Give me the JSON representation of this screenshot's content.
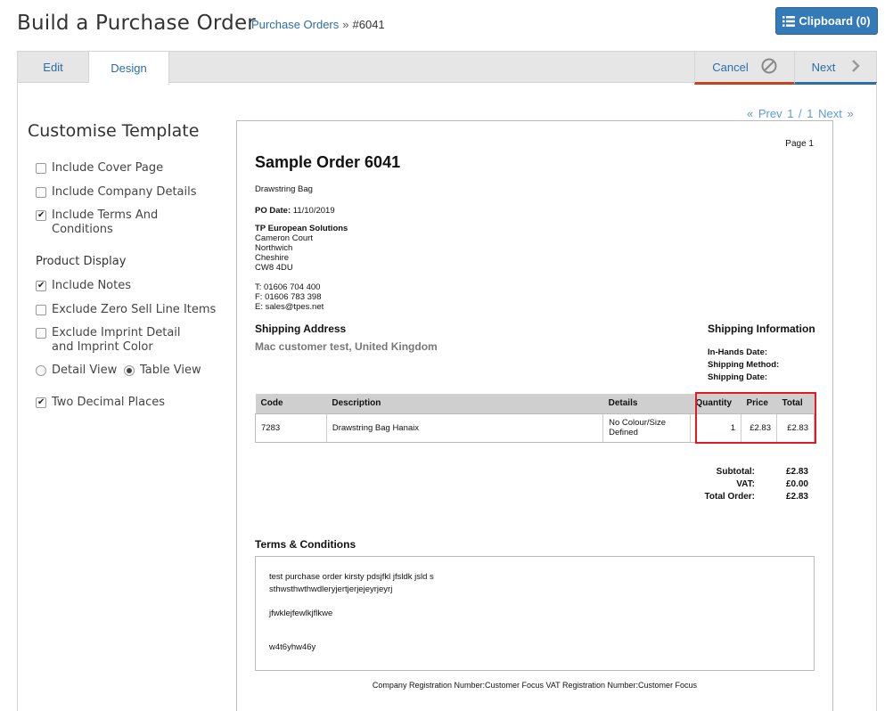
{
  "header": {
    "title": "Build a Purchase Order",
    "breadcrumb_link": "Purchase Orders",
    "breadcrumb_sep": "»",
    "breadcrumb_current": "#6041",
    "clipboard_label": "Clipboard (0)"
  },
  "tabs": {
    "edit": "Edit",
    "design": "Design",
    "cancel": "Cancel",
    "next": "Next"
  },
  "sidebar": {
    "title": "Customise Template",
    "options": [
      {
        "label": "Include Cover Page",
        "checked": false
      },
      {
        "label": "Include Company Details",
        "checked": false
      },
      {
        "label": "Include Terms And Conditions",
        "checked": true
      }
    ],
    "product_display_label": "Product Display",
    "product_options": [
      {
        "label": "Include Notes",
        "checked": true
      },
      {
        "label": "Exclude Zero Sell Line Items",
        "checked": false
      },
      {
        "label": "Exclude Imprint Detail and Imprint Color",
        "checked": false
      }
    ],
    "view_detail": "Detail View",
    "view_table": "Table View",
    "selected_view": "Table View",
    "two_decimal": "Two Decimal Places",
    "two_decimal_checked": true
  },
  "pager": {
    "prev": "« Prev",
    "position": "1 / 1",
    "next": "Next »"
  },
  "preview": {
    "page_label": "Page 1",
    "order_title": "Sample Order 6041",
    "subtitle": "Drawstring Bag",
    "po_date_label": "PO Date:",
    "po_date": "11/10/2019",
    "company_name": "TP European Solutions",
    "address": [
      "Cameron Court",
      "Northwich",
      "Cheshire",
      "CW8 4DU"
    ],
    "phone": "T: 01606 704 400",
    "fax": "F: 01606 783 398",
    "email": "E: sales@tpes.net",
    "shipping_address_label": "Shipping Address",
    "shipping_address": "Mac customer test, United Kingdom",
    "shipping_info_label": "Shipping Information",
    "in_hands_label": "In-Hands Date:",
    "shipping_method_label": "Shipping Method:",
    "shipping_date_label": "Shipping Date:",
    "columns": [
      "Code",
      "Description",
      "Details",
      "Quantity",
      "Price",
      "Total"
    ],
    "rows": [
      {
        "code": "7283",
        "description": "Drawstring Bag Hanaix",
        "details": "No Colour/Size Defined",
        "quantity": "1",
        "price": "£2.83",
        "total": "£2.83"
      }
    ],
    "subtotal_label": "Subtotal:",
    "subtotal": "£2.83",
    "vat_label": "VAT:",
    "vat": "£0.00",
    "total_label": "Total Order:",
    "total": "£2.83",
    "terms_label": "Terms & Conditions",
    "terms_lines": [
      "test purchase order kirsty pdsjfkl jfsldk jsld s",
      "sthwsthwthwdleryjertjerjejeyrjeyrj",
      "jfwklejfewlkjflkwe",
      "w4t6yhw46y"
    ],
    "footer": "Company Registration Number:Customer Focus VAT Registration Number:Customer Focus"
  },
  "colors": {
    "accent": "#337ab7",
    "link": "#2a6ea6",
    "cancel_underline": "#c9421b",
    "highlight": "#e01b24"
  }
}
